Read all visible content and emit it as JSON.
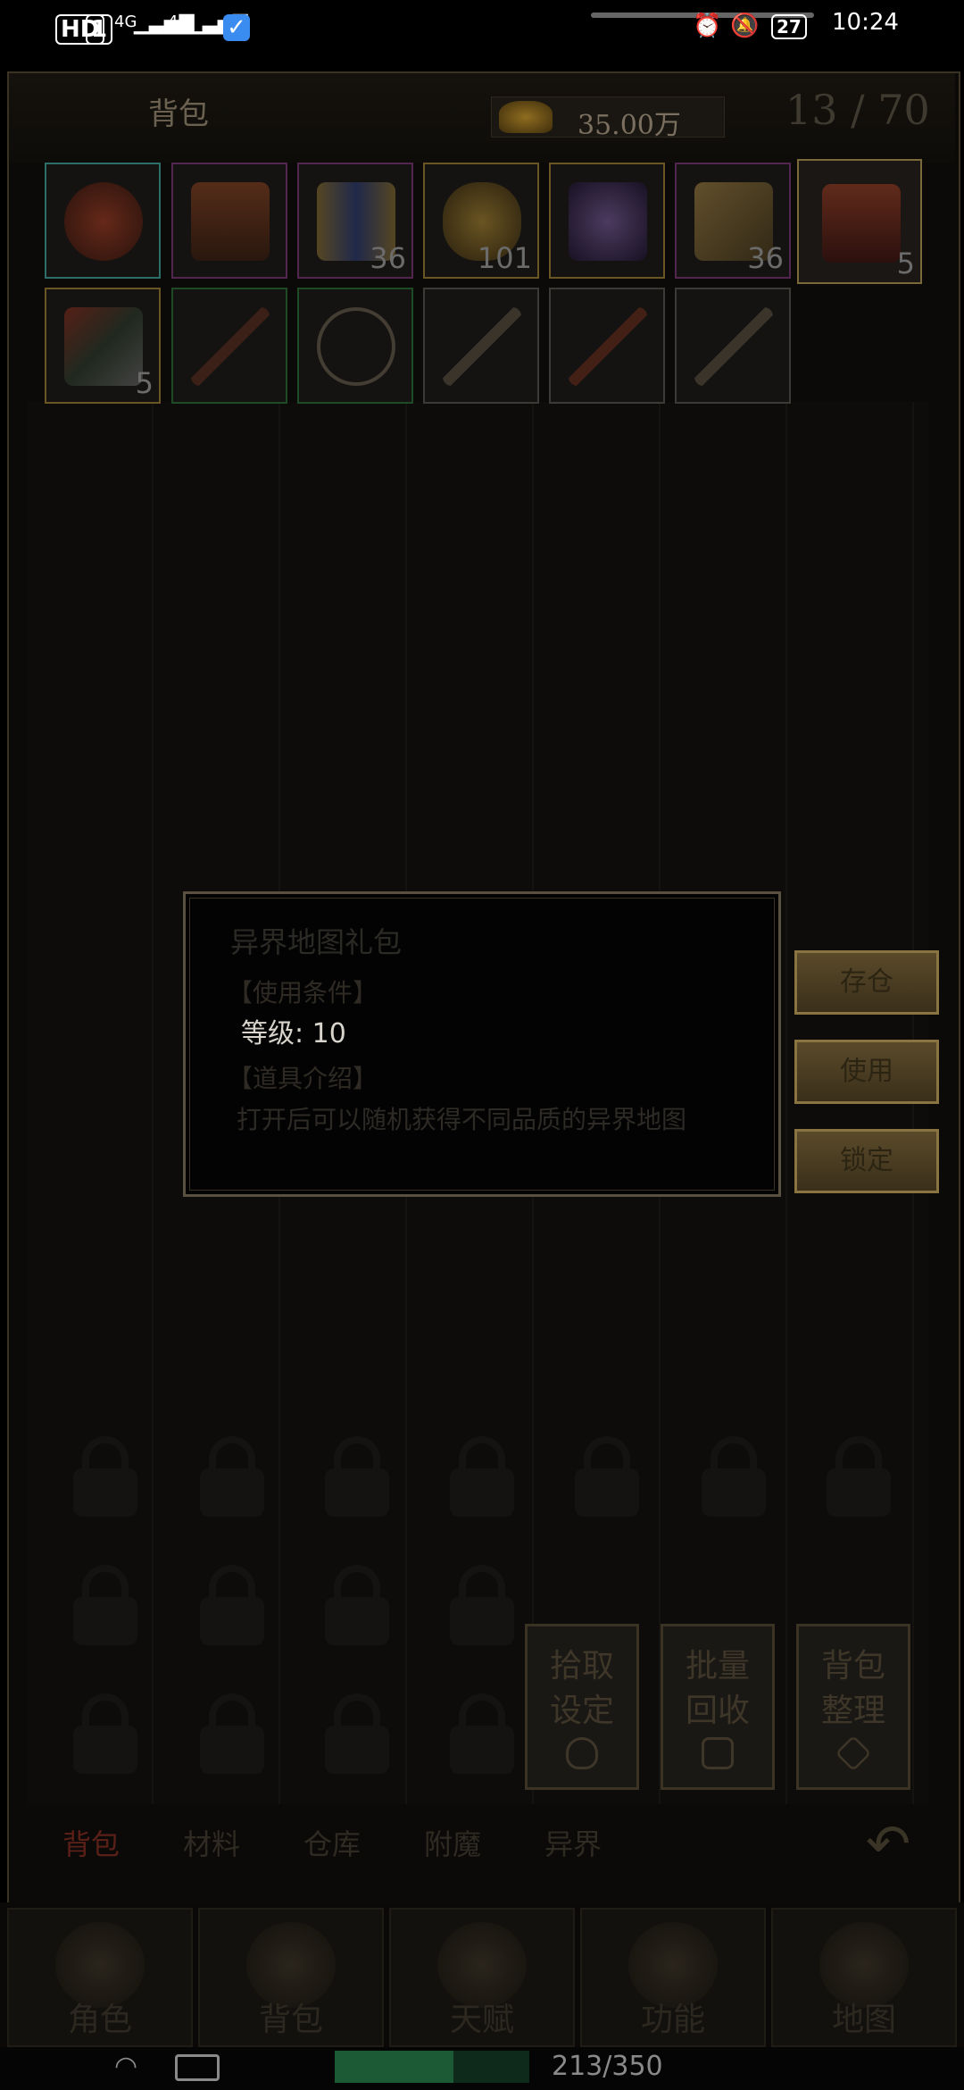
{
  "statusbar": {
    "hd": "HD",
    "sim1": "1",
    "signal1": "4G",
    "signal2": "4G",
    "battery": "27",
    "time": "10:24"
  },
  "bag": {
    "title": "背包",
    "money": "35.00万",
    "capacity": "13 / 70"
  },
  "items_row1": [
    {
      "count": "",
      "icon": "jade-seal-icon",
      "color": "#8a2a1a"
    },
    {
      "count": "",
      "icon": "treasure-chest-icon",
      "color": "#6a3018"
    },
    {
      "count": "36",
      "icon": "scroll-2x-icon",
      "color": "#6a5a2a"
    },
    {
      "count": "101",
      "icon": "gourd-icon",
      "color": "#8a6a20"
    },
    {
      "count": "",
      "icon": "crystal-bag-icon",
      "color": "#4a3a6a"
    },
    {
      "count": "36",
      "icon": "paper-scroll-icon",
      "color": "#7a6030"
    },
    {
      "count": "5",
      "icon": "red-chest-icon",
      "color": "#6a2a1a"
    }
  ],
  "items_row2": [
    {
      "count": "5",
      "icon": "dart-icon",
      "color": "#5a2a20"
    },
    {
      "count": "",
      "icon": "sword-icon",
      "color": "#4a2a1a"
    },
    {
      "count": "",
      "icon": "necklace-icon",
      "color": "#6a6050"
    },
    {
      "count": "",
      "icon": "dagger-icon",
      "color": "#4a4030"
    },
    {
      "count": "",
      "icon": "blade-icon",
      "color": "#5a2a1a"
    },
    {
      "count": "",
      "icon": "knife-icon",
      "color": "#4a4030"
    }
  ],
  "tooltip": {
    "title": "异界地图礼包",
    "usage_header": "【使用条件】",
    "level": "等级: 10",
    "intro_header": "【道具介绍】",
    "description": "打开后可以随机获得不同品质的异界地图"
  },
  "actions": {
    "store": "存仓",
    "use": "使用",
    "lock": "锁定"
  },
  "utility": {
    "pickup": "拾取\n设定",
    "recycle": "批量\n回收",
    "sort": "背包\n整理"
  },
  "category_tabs": [
    "背包",
    "材料",
    "仓库",
    "附魔",
    "异界"
  ],
  "nav": [
    "角色",
    "背包",
    "天赋",
    "功能",
    "地图"
  ],
  "exp": {
    "text": "213/350",
    "fraction": 0.61
  }
}
